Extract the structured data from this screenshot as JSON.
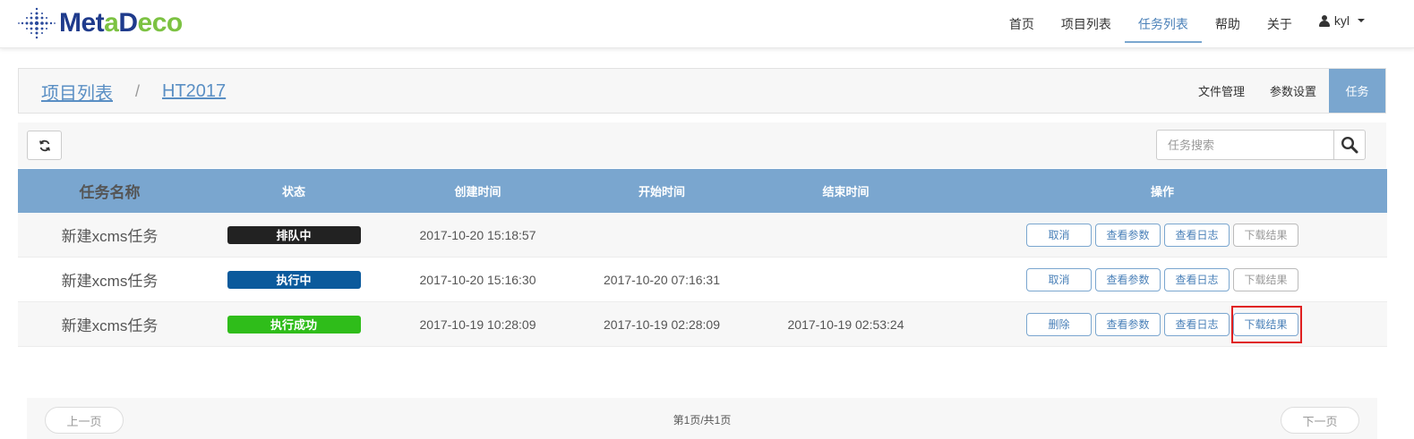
{
  "brand": {
    "part1": "Met",
    "part2": "a",
    "part3": "D",
    "part4": "eco",
    "primary_color": "#1f3b8c",
    "accent_color": "#7cc242"
  },
  "nav": {
    "items": [
      {
        "label": "首页",
        "icon": null
      },
      {
        "label": "项目列表",
        "icon": null
      },
      {
        "label": "任务列表",
        "icon": null,
        "active": true
      },
      {
        "label": "帮助",
        "icon": null
      },
      {
        "label": "关于",
        "icon": null
      }
    ],
    "user": {
      "name": "kyl",
      "icon": "user-icon"
    }
  },
  "breadcrumb": {
    "items": [
      "项目列表",
      "HT2017"
    ],
    "separator": "/"
  },
  "sub_tabs": [
    {
      "label": "文件管理"
    },
    {
      "label": "参数设置"
    },
    {
      "label": "任务",
      "active": true
    }
  ],
  "toolbar": {
    "refresh_icon": "refresh-icon",
    "search_placeholder": "任务搜索",
    "search_icon": "magnifier-icon"
  },
  "table": {
    "header_color": "#7aa6cf",
    "columns": [
      "任务名称",
      "状态",
      "创建时间",
      "开始时间",
      "结束时间",
      "操作"
    ],
    "rows": [
      {
        "name": "新建xcms任务",
        "status": "排队中",
        "status_color": "#222222",
        "created": "2017-10-20 15:18:57",
        "started": "",
        "ended": "",
        "actions": [
          "取消",
          "查看参数",
          "查看日志",
          "下载结果"
        ],
        "disabled_actions": [
          3
        ]
      },
      {
        "name": "新建xcms任务",
        "status": "执行中",
        "status_color": "#0b5a9c",
        "created": "2017-10-20 15:16:30",
        "started": "2017-10-20 07:16:31",
        "ended": "",
        "actions": [
          "取消",
          "查看参数",
          "查看日志",
          "下载结果"
        ],
        "disabled_actions": [
          3
        ]
      },
      {
        "name": "新建xcms任务",
        "status": "执行成功",
        "status_color": "#2fbd1a",
        "created": "2017-10-19 10:28:09",
        "started": "2017-10-19 02:28:09",
        "ended": "2017-10-19 02:53:24",
        "actions": [
          "删除",
          "查看参数",
          "查看日志",
          "下载结果"
        ],
        "disabled_actions": [],
        "highlighted_action": 3
      }
    ]
  },
  "pagination": {
    "prev": "上一页",
    "info": "第1页/共1页",
    "next": "下一页"
  }
}
